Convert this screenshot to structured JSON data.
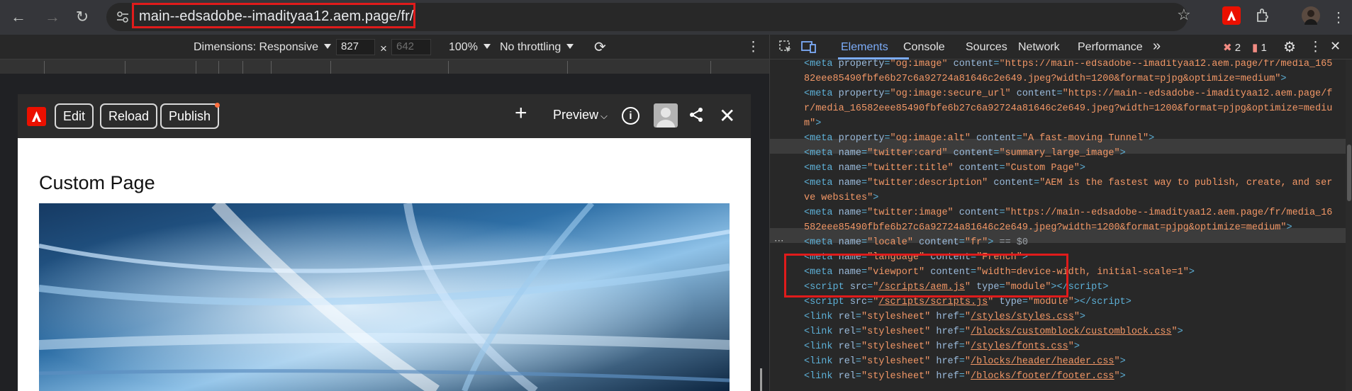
{
  "browser": {
    "url": "main--edsadobe--imadityaa12.aem.page/fr/"
  },
  "device_toolbar": {
    "dimensions_label": "Dimensions: Responsive",
    "width": "827",
    "height": "642",
    "zoom": "100%",
    "throttling": "No throttling"
  },
  "sidekick": {
    "edit": "Edit",
    "reload": "Reload",
    "publish": "Publish",
    "preview": "Preview"
  },
  "page": {
    "title": "Custom Page"
  },
  "devtools": {
    "tabs": [
      "Elements",
      "Console",
      "Sources",
      "Network",
      "Performance"
    ],
    "errors": "2",
    "warnings": "1",
    "dollar_zero": "== $0"
  },
  "colors": {
    "highlight_box": "#e01b1b",
    "adobe_red": "#eb1000",
    "active_tab": "#7cacf8"
  }
}
